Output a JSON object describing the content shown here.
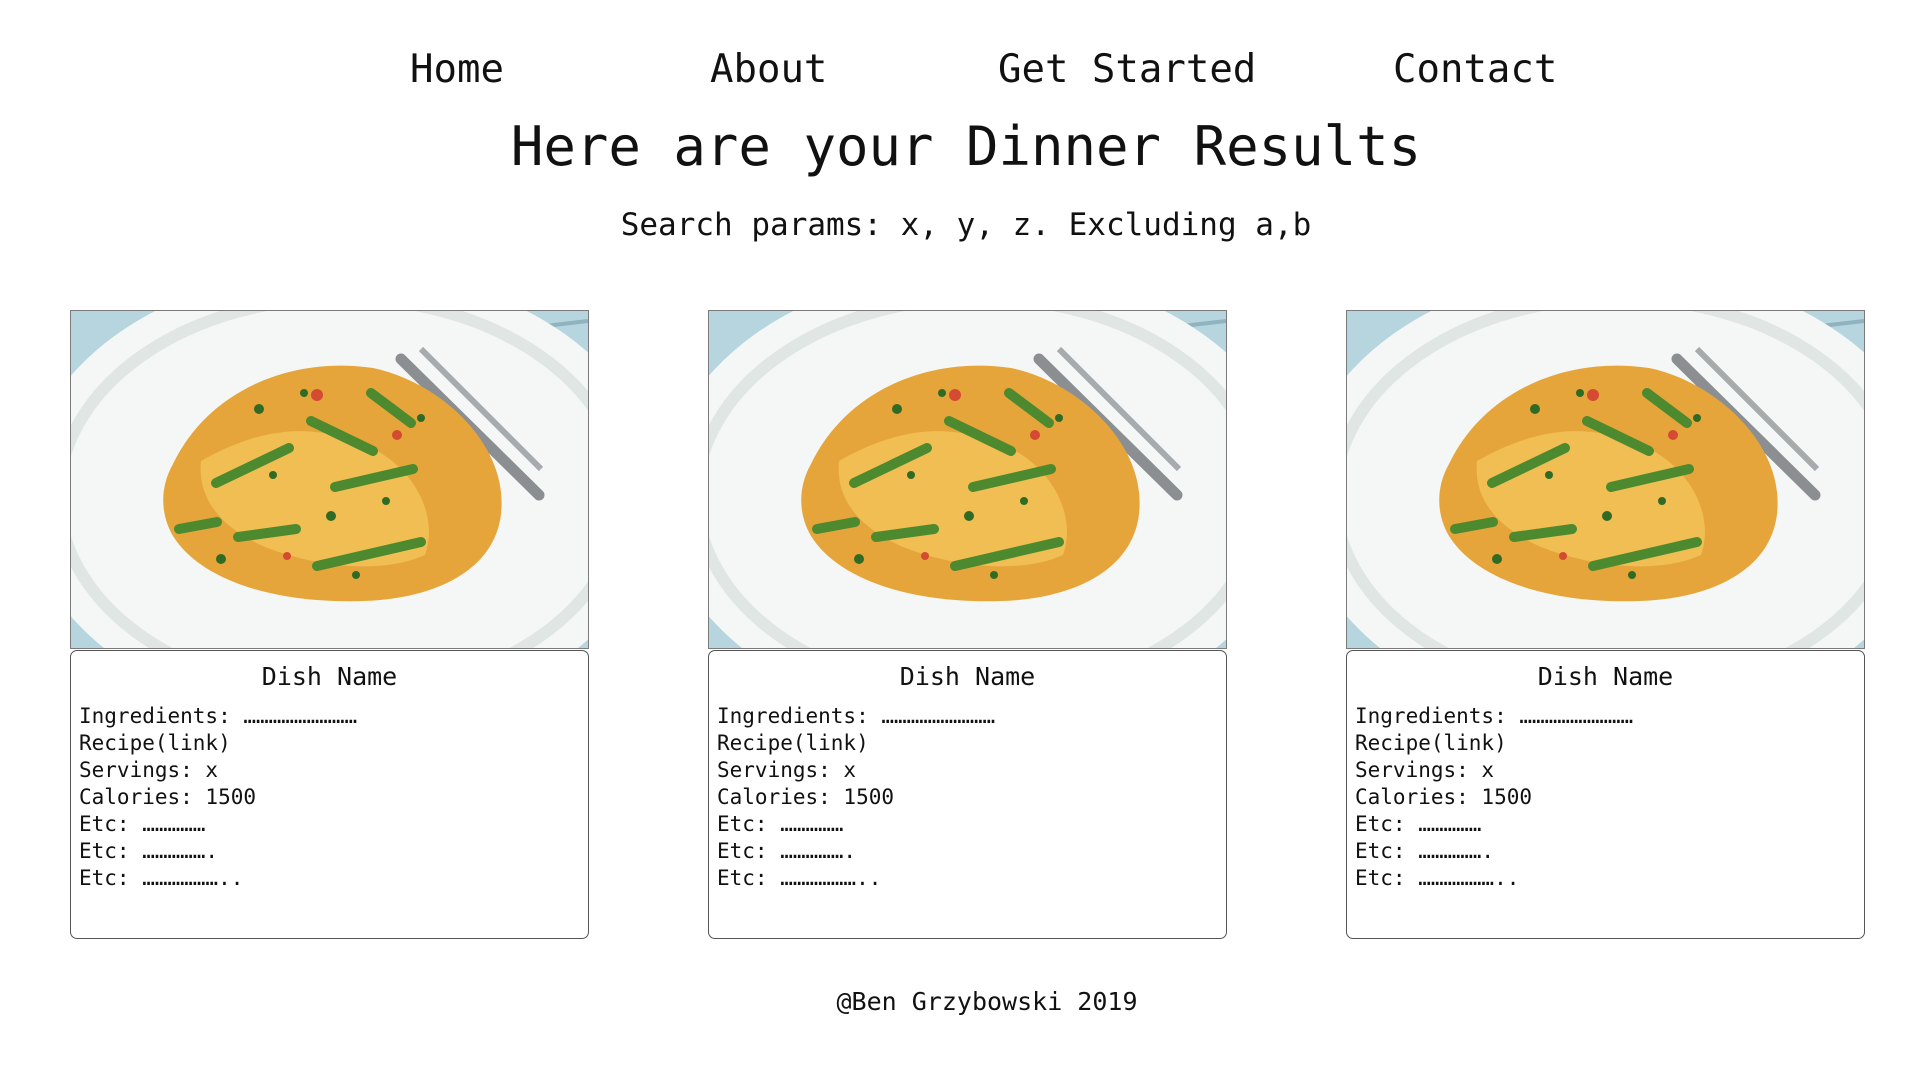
{
  "nav": {
    "home": "Home",
    "about": "About",
    "get_started": "Get Started",
    "contact": "Contact"
  },
  "header": {
    "title": "Here are your Dinner Results",
    "search_params": "Search params: x, y, z. Excluding a,b"
  },
  "cards": [
    {
      "dish_name": "Dish Name",
      "ingredients": "Ingredients: ………………………",
      "recipe": "Recipe(link)",
      "servings": "Servings: x",
      "calories": "Calories: 1500",
      "etc1": "Etc: ……………",
      "etc2": "Etc: …………….",
      "etc3": "Etc: ………………..",
      "image_alt": "pasta-dish-photo"
    },
    {
      "dish_name": "Dish Name",
      "ingredients": "Ingredients: ………………………",
      "recipe": "Recipe(link)",
      "servings": "Servings: x",
      "calories": "Calories: 1500",
      "etc1": "Etc: ……………",
      "etc2": "Etc: …………….",
      "etc3": "Etc: ………………..",
      "image_alt": "pasta-dish-photo"
    },
    {
      "dish_name": "Dish Name",
      "ingredients": "Ingredients: ………………………",
      "recipe": "Recipe(link)",
      "servings": "Servings: x",
      "calories": "Calories: 1500",
      "etc1": "Etc: ……………",
      "etc2": "Etc: …………….",
      "etc3": "Etc: ………………..",
      "image_alt": "pasta-dish-photo"
    }
  ],
  "footer": {
    "text": "@Ben Grzybowski 2019"
  },
  "colors": {
    "background": "#ffffff",
    "text": "#111111",
    "table_blue": "#b6d5de",
    "plate": "#f4f7f5",
    "pasta": "#e6a53b",
    "asparagus": "#4d8a2f"
  }
}
